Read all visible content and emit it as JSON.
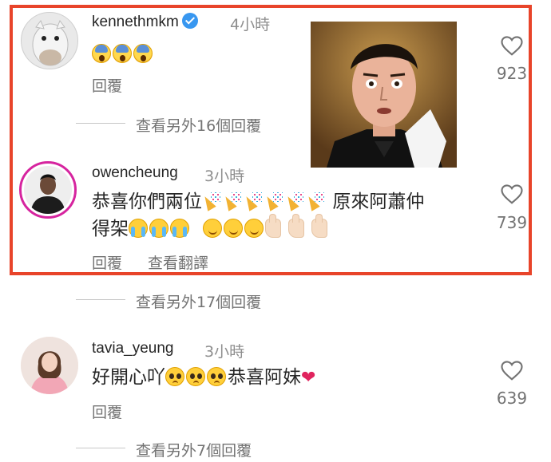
{
  "comments": [
    {
      "username": "kennethmkm",
      "verified": true,
      "time": "4小時",
      "emojis": [
        "scream",
        "scream",
        "scream"
      ],
      "reply_label": "回覆",
      "likes": "923",
      "view_more": "查看另外16個回覆"
    },
    {
      "username": "owencheung",
      "time": "3小時",
      "line1_text": "恭喜你們兩位",
      "line1_text2": "原來阿蕭仲",
      "line2_text": "得架",
      "reply_label": "回覆",
      "translate_label": "查看翻譯",
      "likes": "739",
      "view_more": "查看另外17個回覆"
    },
    {
      "username": "tavia_yeung",
      "time": "3小時",
      "text1": "好開心吖",
      "text2": "恭喜阿妹",
      "reply_label": "回覆",
      "likes": "639",
      "view_more": "查看另外7個回覆"
    }
  ],
  "colors": {
    "highlight_border": "#e8442a",
    "heart_emoji": "#e0245e",
    "verified_badge": "#3897f0",
    "secondary_text": "#737373"
  },
  "icons": [
    "heart-outline-icon",
    "verified-badge-icon"
  ]
}
